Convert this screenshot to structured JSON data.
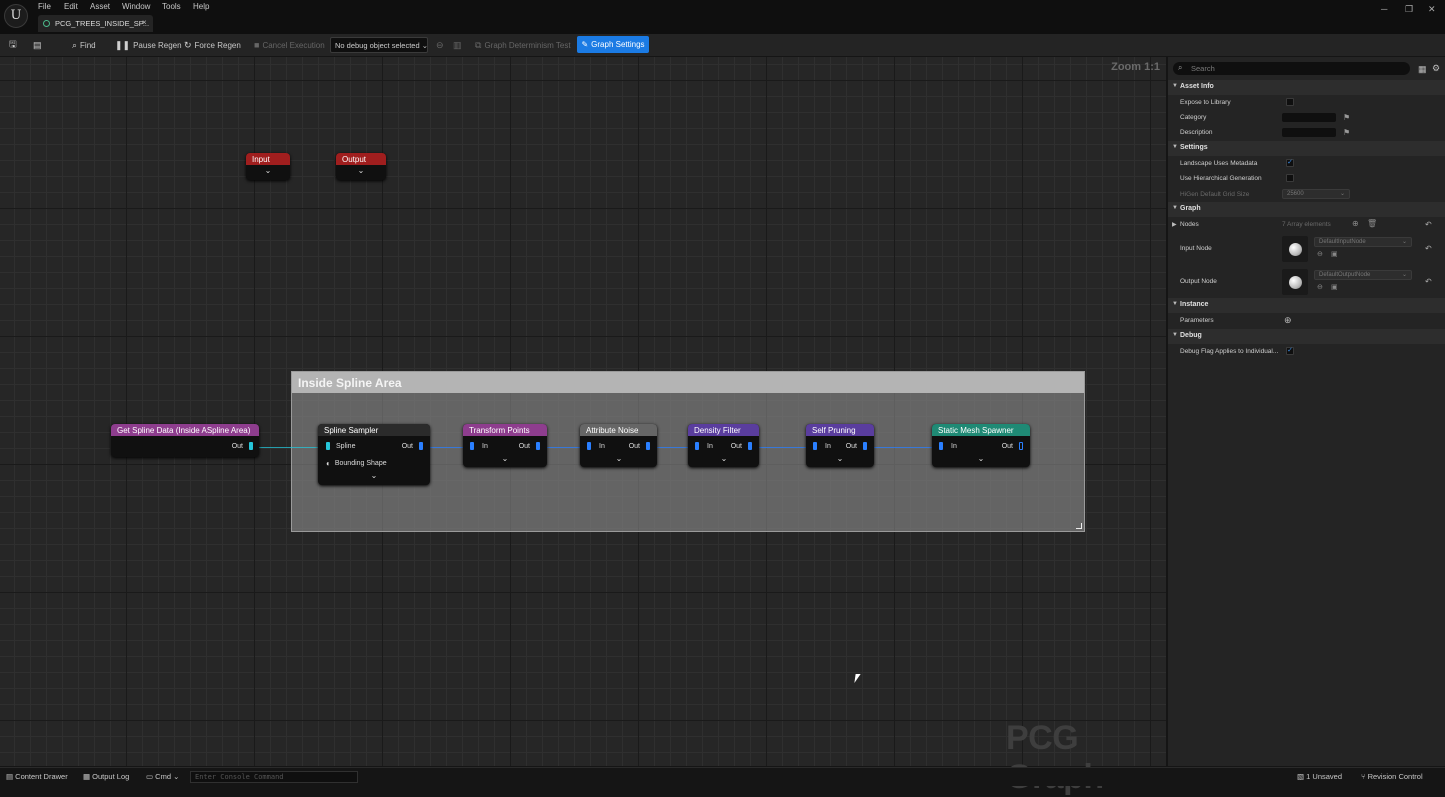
{
  "menu": [
    "File",
    "Edit",
    "Asset",
    "Window",
    "Tools",
    "Help"
  ],
  "tab": {
    "label": "PCG_TREES_INSIDE_SP...",
    "close": "×"
  },
  "window_controls": {
    "minimize": "─",
    "restore": "❐",
    "close": "✕"
  },
  "toolbar": {
    "find": "Find",
    "pause_regen": "Pause Regen",
    "force_regen": "Force Regen",
    "cancel_execution": "Cancel Execution",
    "debug_object": "No debug object selected",
    "determinism_test": "Graph Determinism Test",
    "graph_settings": "Graph Settings"
  },
  "graph": {
    "zoom": "Zoom 1:1",
    "watermark": "PCG Graph",
    "comment_title": "Inside Spline Area",
    "nodes": {
      "input": {
        "title": "Input",
        "color": "#a01e1e"
      },
      "output": {
        "title": "Output",
        "color": "#a01e1e"
      },
      "get_spline": {
        "title": "Get Spline Data (Inside ASpline Area)",
        "out": "Out",
        "color": "#8e3d8e"
      },
      "spline_sampler": {
        "title": "Spline Sampler",
        "in1": "Spline",
        "in2": "Bounding Shape",
        "out": "Out",
        "color": "#2b2b2b"
      },
      "transform_points": {
        "title": "Transform Points",
        "in": "In",
        "out": "Out",
        "color": "#8e3d8e"
      },
      "attribute_noise": {
        "title": "Attribute Noise",
        "in": "In",
        "out": "Out",
        "color": "#666666"
      },
      "density_filter": {
        "title": "Density Filter",
        "in": "In",
        "out": "Out",
        "color": "#5a3d9e"
      },
      "self_pruning": {
        "title": "Self Pruning",
        "in": "In",
        "out": "Out",
        "color": "#5a3d9e"
      },
      "static_mesh_spawner": {
        "title": "Static Mesh Spawner",
        "in": "In",
        "out": "Out",
        "color": "#1f8a75"
      }
    }
  },
  "details": {
    "search_placeholder": "Search",
    "asset_info": {
      "header": "Asset Info",
      "expose_to_library": "Expose to Library",
      "category": "Category",
      "description": "Description"
    },
    "settings": {
      "header": "Settings",
      "landscape_uses_metadata": "Landscape Uses Metadata",
      "use_hierarchical_generation": "Use Hierarchical Generation",
      "higen_grid_size": "HiGen Default Grid Size",
      "higen_grid_value": "25600"
    },
    "graph": {
      "header": "Graph",
      "nodes": "Nodes",
      "nodes_value": "7 Array elements",
      "input_node": "Input Node",
      "input_node_value": "DefaultInputNode",
      "output_node": "Output Node",
      "output_node_value": "DefaultOutputNode"
    },
    "instance": {
      "header": "Instance",
      "parameters": "Parameters"
    },
    "debug": {
      "header": "Debug",
      "debug_flag": "Debug Flag Applies to Individual..."
    }
  },
  "statusbar": {
    "content_drawer": "Content Drawer",
    "output_log": "Output Log",
    "cmd": "Cmd",
    "console_placeholder": "Enter Console Command",
    "unsaved": "1 Unsaved",
    "revision_control": "Revision Control"
  }
}
